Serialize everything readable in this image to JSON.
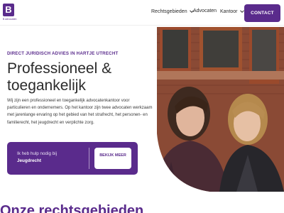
{
  "brand": {
    "logo_letter": "B",
    "logo_text": "B advocaten",
    "accent": "#5a2b8c"
  },
  "nav": {
    "items": [
      {
        "label": "Rechtsgebieden",
        "has_dropdown": true
      },
      {
        "label": "Advocaten",
        "has_dropdown": false
      },
      {
        "label": "Kantoor",
        "has_dropdown": true
      }
    ],
    "contact_label": "CONTACT"
  },
  "hero": {
    "eyebrow": "DIRECT JURIDISCH ADVIES IN HARTJE UTRECHT",
    "title": "Professioneel & toegankelijk",
    "lead": "Wij zijn een professioneel en toegankelijk advocatenkantoor voor particulieren en ondernemers. Op het kantoor zijn twee advocaten werkzaam met jarenlange ervaring op het gebied van het strafrecht, het personen- en familierecht, het jeugdrecht en verplichte zorg.",
    "cta": {
      "line1": "Ik heb hulp nodig bij",
      "line2": "Jeugdrecht",
      "button": "BEKIJK MEER"
    },
    "photo_icon": "two-women-portrait-photo"
  },
  "bottom": {
    "heading": "Onze rechtsgebieden"
  }
}
